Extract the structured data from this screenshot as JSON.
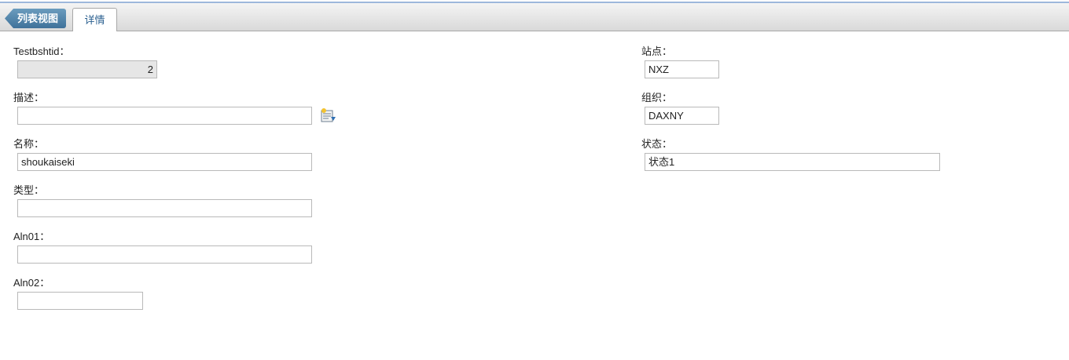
{
  "tabs": {
    "back_label": "列表视图",
    "detail_label": "详情"
  },
  "left": {
    "testbshtid": {
      "label": "Testbshtid：",
      "value": "2"
    },
    "description": {
      "label": "描述：",
      "value": ""
    },
    "name": {
      "label": "名称：",
      "value": "shoukaiseki"
    },
    "type": {
      "label": "类型：",
      "value": ""
    },
    "aln01": {
      "label": "Aln01：",
      "value": ""
    },
    "aln02": {
      "label": "Aln02：",
      "value": ""
    }
  },
  "right": {
    "site": {
      "label": "站点：",
      "value": "NXZ"
    },
    "org": {
      "label": "组织：",
      "value": "DAXNY"
    },
    "status": {
      "label": "状态：",
      "value": "状态1"
    }
  },
  "icons": {
    "long_description": "long-description-icon"
  }
}
